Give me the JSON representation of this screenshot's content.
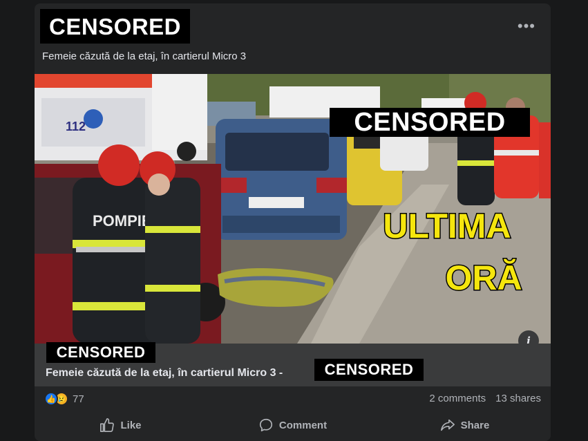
{
  "post": {
    "author_censor": "CENSORED",
    "more_label": "•••",
    "text": "Femeie căzută de la etaj, în cartierul Micro 3"
  },
  "media": {
    "image_censor": "CENSORED",
    "overlay_line1": "ULTIMA",
    "overlay_line2": "ORĂ",
    "vest_text": "POMPIERI",
    "plate_text": "112",
    "info_label": "i"
  },
  "link": {
    "domain_censor": "CENSORED",
    "title": "Femeie căzută de la etaj, în cartierul Micro 3 -",
    "title_censor": "CENSORED"
  },
  "reactions": {
    "like_icon": "👍",
    "sad_icon": "😢",
    "count": "77"
  },
  "stats": {
    "comments": "2 comments",
    "shares": "13 shares"
  },
  "actions": {
    "like": "Like",
    "comment": "Comment",
    "share": "Share"
  },
  "colors": {
    "background": "#18191a",
    "card": "#242526",
    "link_area": "#3a3b3c",
    "accent": "#1877f2",
    "overlay_yellow": "#f5e60e"
  }
}
